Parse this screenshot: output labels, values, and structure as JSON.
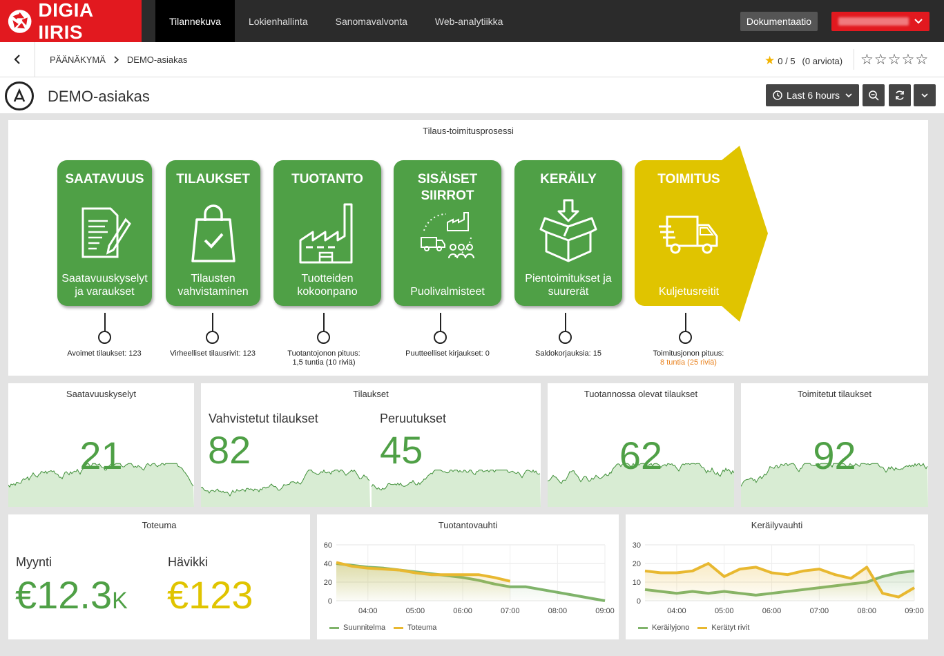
{
  "nav": {
    "brand": "DIGIA IIRIS",
    "items": [
      "Tilannekuva",
      "Lokienhallinta",
      "Sanomavalvonta",
      "Web-analytiikka"
    ],
    "doc_label": "Dokumentaatio"
  },
  "breadcrumb": {
    "home": "PÄÄNÄKYMÄ",
    "current": "DEMO-asiakas"
  },
  "rating": {
    "score": "0 / 5",
    "count": "(0 arviota)"
  },
  "page": {
    "title": "DEMO-asiakas",
    "time_range": "Last 6 hours"
  },
  "process": {
    "title": "Tilaus-toimitusprosessi",
    "steps": [
      {
        "title": "SAATAVUUS",
        "sub": "Saatavuuskyselyt ja varaukset",
        "pin": "Avoimet tilaukset: 123"
      },
      {
        "title": "TILAUKSET",
        "sub": "Tilausten vahvistaminen",
        "pin": "Virheelliset tilausrivit: 123"
      },
      {
        "title": "TUOTANTO",
        "sub": "Tuotteiden kokoonpano",
        "pin": "Tuotantojonon pituus:",
        "pin2": "1,5 tuntia (10 riviä)"
      },
      {
        "title": "SISÄISET SIIRROT",
        "sub": "Puolivalmisteet",
        "pin": "Puutteelliset kirjaukset: 0"
      },
      {
        "title": "KERÄILY",
        "sub": "Pientoimitukset ja suurerät",
        "pin": "Saldokorjauksia: 15"
      },
      {
        "title": "TOIMITUS",
        "sub": "Kuljetusreitit",
        "pin": "Toimitusjonon pituus:",
        "pin2": "8 tuntia (25 riviä)"
      }
    ]
  },
  "stats": {
    "saatavuus": {
      "title": "Saatavuuskyselyt",
      "value": "21"
    },
    "tilaukset": {
      "title": "Tilaukset",
      "label1": "Vahvistetut tilaukset",
      "value1": "82",
      "label2": "Peruutukset",
      "value2": "45"
    },
    "tuotanto": {
      "title": "Tuotannossa olevat tilaukset",
      "value": "62"
    },
    "toimitetut": {
      "title": "Toimitetut tilaukset",
      "value": "92"
    }
  },
  "toteuma": {
    "title": "Toteuma",
    "label1": "Myynti",
    "value1": "€12.3",
    "unit1": "K",
    "label2": "Hävikki",
    "value2": "€123"
  },
  "colors": {
    "green": "#4fa046",
    "yellow": "#e0c400",
    "red": "#e2191f",
    "orange": "#e9821e"
  },
  "chart_data": [
    {
      "type": "line",
      "title": "Tuotantovauhti",
      "x": [
        "03:20",
        "03:40",
        "04:00",
        "04:20",
        "04:40",
        "05:00",
        "05:20",
        "05:40",
        "06:00",
        "06:20",
        "06:40",
        "07:00",
        "07:20",
        "07:40",
        "08:00",
        "08:20",
        "08:40",
        "09:00"
      ],
      "xticks": [
        "04:00",
        "05:00",
        "06:00",
        "07:00",
        "08:00",
        "09:00"
      ],
      "yticks": [
        0,
        20,
        40,
        60
      ],
      "ylim": [
        0,
        60
      ],
      "series": [
        {
          "name": "Suunnitelma",
          "color": "#7fb36a",
          "values": [
            40,
            38,
            36,
            35,
            33,
            31,
            29,
            27,
            25,
            22,
            18,
            15,
            15,
            12,
            9,
            6,
            3,
            0
          ]
        },
        {
          "name": "Toteuma",
          "color": "#e8b830",
          "values": [
            41,
            37,
            35,
            34,
            33,
            30,
            28,
            28,
            28,
            28,
            25,
            21,
            null,
            null,
            null,
            null,
            null,
            null
          ]
        }
      ]
    },
    {
      "type": "line",
      "title": "Keräilyvauhti",
      "x": [
        "03:20",
        "03:40",
        "04:00",
        "04:20",
        "04:40",
        "05:00",
        "05:20",
        "05:40",
        "06:00",
        "06:20",
        "06:40",
        "07:00",
        "07:20",
        "07:40",
        "08:00",
        "08:20",
        "08:40",
        "09:00"
      ],
      "xticks": [
        "04:00",
        "05:00",
        "06:00",
        "07:00",
        "08:00",
        "09:00"
      ],
      "yticks": [
        0,
        10,
        20,
        30
      ],
      "ylim": [
        0,
        30
      ],
      "series": [
        {
          "name": "Keräilyjono",
          "color": "#7fb36a",
          "values": [
            6,
            5,
            4,
            5,
            4,
            5,
            4,
            3,
            4,
            5,
            6,
            7,
            8,
            9,
            10,
            13,
            15,
            16
          ]
        },
        {
          "name": "Kerätyt rivit",
          "color": "#e8b830",
          "values": [
            16,
            15,
            15,
            16,
            20,
            13,
            17,
            18,
            15,
            14,
            16,
            17,
            14,
            12,
            18,
            4,
            2,
            7
          ]
        }
      ]
    }
  ]
}
